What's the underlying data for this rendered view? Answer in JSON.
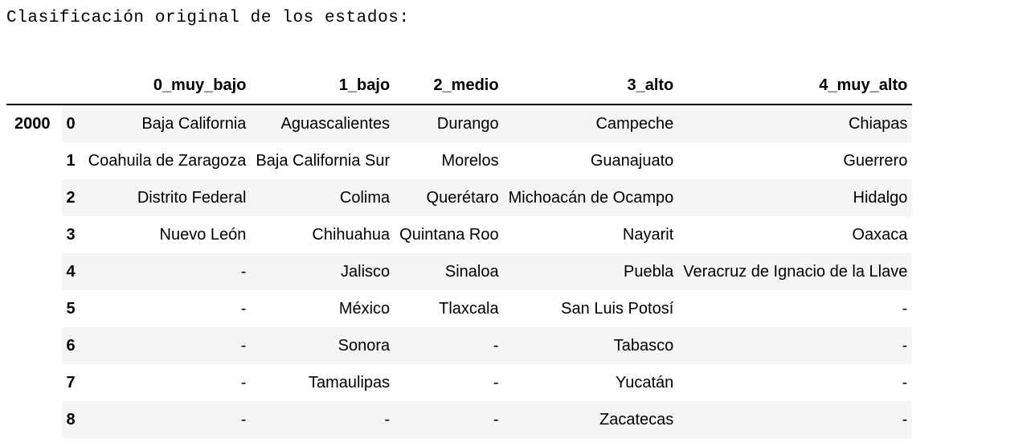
{
  "output": {
    "caption": "Clasificación original de los estados:"
  },
  "table": {
    "columns": [
      "0_muy_bajo",
      "1_bajo",
      "2_medio",
      "3_alto",
      "4_muy_alto"
    ],
    "outer_index": "2000",
    "rows": [
      {
        "idx": "0",
        "cells": [
          "Baja California",
          "Aguascalientes",
          "Durango",
          "Campeche",
          "Chiapas"
        ]
      },
      {
        "idx": "1",
        "cells": [
          "Coahuila de Zaragoza",
          "Baja California Sur",
          "Morelos",
          "Guanajuato",
          "Guerrero"
        ]
      },
      {
        "idx": "2",
        "cells": [
          "Distrito Federal",
          "Colima",
          "Querétaro",
          "Michoacán de Ocampo",
          "Hidalgo"
        ]
      },
      {
        "idx": "3",
        "cells": [
          "Nuevo León",
          "Chihuahua",
          "Quintana Roo",
          "Nayarit",
          "Oaxaca"
        ]
      },
      {
        "idx": "4",
        "cells": [
          "-",
          "Jalisco",
          "Sinaloa",
          "Puebla",
          "Veracruz de Ignacio de la Llave"
        ]
      },
      {
        "idx": "5",
        "cells": [
          "-",
          "México",
          "Tlaxcala",
          "San Luis Potosí",
          "-"
        ]
      },
      {
        "idx": "6",
        "cells": [
          "-",
          "Sonora",
          "-",
          "Tabasco",
          "-"
        ]
      },
      {
        "idx": "7",
        "cells": [
          "-",
          "Tamaulipas",
          "-",
          "Yucatán",
          "-"
        ]
      },
      {
        "idx": "8",
        "cells": [
          "-",
          "-",
          "-",
          "Zacatecas",
          "-"
        ]
      }
    ]
  }
}
